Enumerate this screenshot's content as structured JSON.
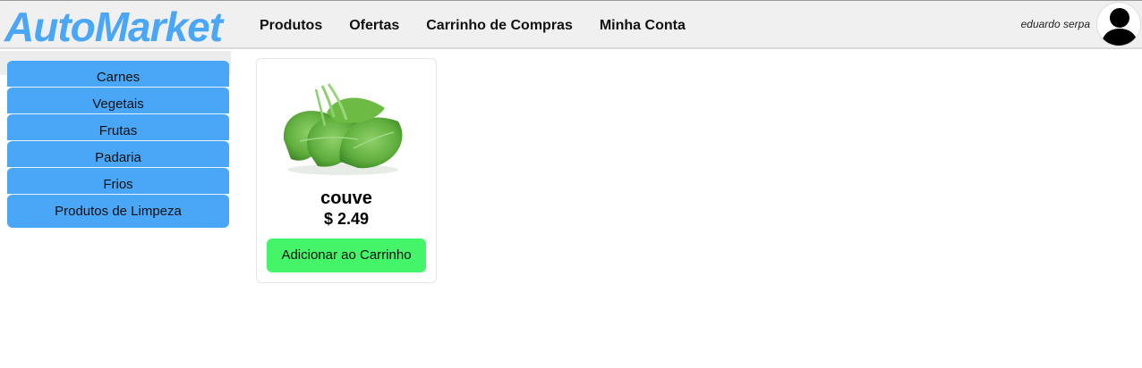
{
  "header": {
    "logo": "AutoMarket",
    "nav": [
      "Produtos",
      "Ofertas",
      "Carrinho de Compras",
      "Minha Conta"
    ],
    "username": "eduardo serpa",
    "avatar_icon": "user-silhouette-icon"
  },
  "sidebar": {
    "categories": [
      "Carnes",
      "Vegetais",
      "Frutas",
      "Padaria",
      "Frios",
      "Produtos de Limpeza"
    ]
  },
  "products": [
    {
      "name": "couve",
      "price": "$ 2.49",
      "button_label": "Adicionar ao Carrinho",
      "image": "leafy-greens-image"
    }
  ],
  "colors": {
    "brand": "#4aa6f7",
    "add_button": "#44f56a",
    "header_bg": "#f0f0f0"
  }
}
